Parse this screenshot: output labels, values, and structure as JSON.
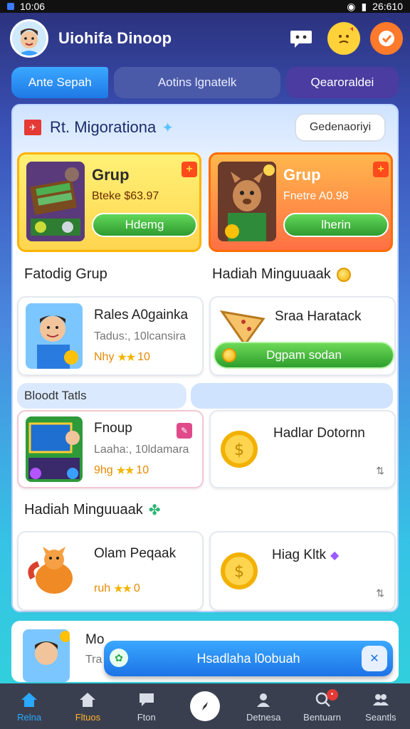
{
  "status_bar": {
    "left_text": "10:06",
    "right_text": "26:610"
  },
  "header": {
    "title": "Uiohifa Dinoop",
    "avatar": "avatar",
    "icons": [
      "chat-bubble-icon",
      "emoji-face-icon",
      "notification-icon"
    ]
  },
  "tabs": [
    {
      "label": "Ante Sepah",
      "active": true
    },
    {
      "label": "Aotins lgnatelk",
      "active": false
    },
    {
      "label": "Qearoraldei",
      "active": false
    }
  ],
  "panel": {
    "title": "Rt. Migorationa",
    "button_label": "Gedenaoriyi"
  },
  "promos": [
    {
      "name": "Grup",
      "price": "Bteke $63.97",
      "button": "Hdemg"
    },
    {
      "name": "Grup",
      "price": "Fnetre A0.98",
      "button": "lherin"
    }
  ],
  "sections": {
    "left_heading": "Fatodig Grup",
    "right_heading": "Hadiah Minguuaak",
    "blue_bar_label": "Bloodt Tatls",
    "bottom_heading": "Hadiah Minguuaak"
  },
  "cards": {
    "c1": {
      "title": "Rales A0gainka",
      "sub": "Tadus:, 10lcansira",
      "rating_prefix": "Nhy",
      "stars": "★★",
      "rating_value": "10"
    },
    "c2": {
      "title": "Sraa Haratack",
      "button": "Dgpam sodan"
    },
    "c3": {
      "title": "Fnoup",
      "sub": "Laaha:, 10ldamara",
      "rating_prefix": "9hg",
      "stars": "★★",
      "rating_value": "10"
    },
    "c4": {
      "title": "Hadlar Dotornn"
    },
    "c5": {
      "title": "Olam Peqaak",
      "rating_prefix": "ruh",
      "stars": "★★",
      "rating_value": "0"
    },
    "c6": {
      "title": "Hiag Kltk"
    },
    "c7": {
      "title": "Mo",
      "sub": "Tra"
    }
  },
  "floating": {
    "label": "Hsadlaha l0obuah"
  },
  "nav": [
    {
      "label": "Relna",
      "icon": "home-icon",
      "state": "active"
    },
    {
      "label": "Fltuos",
      "icon": "house-icon",
      "state": "orange"
    },
    {
      "label": "Fton",
      "icon": "chat-icon",
      "state": ""
    },
    {
      "label": "",
      "icon": "compass-icon",
      "state": "center"
    },
    {
      "label": "Detnesa",
      "icon": "user-icon",
      "state": ""
    },
    {
      "label": "Bentuarn",
      "icon": "search-person-icon",
      "state": "badge"
    },
    {
      "label": "Seantls",
      "icon": "people-icon",
      "state": ""
    }
  ],
  "colors": {
    "accent_blue": "#1f78e6",
    "green": "#2e9b2e",
    "orange": "#ff7043",
    "yellow": "#ffd54f"
  }
}
